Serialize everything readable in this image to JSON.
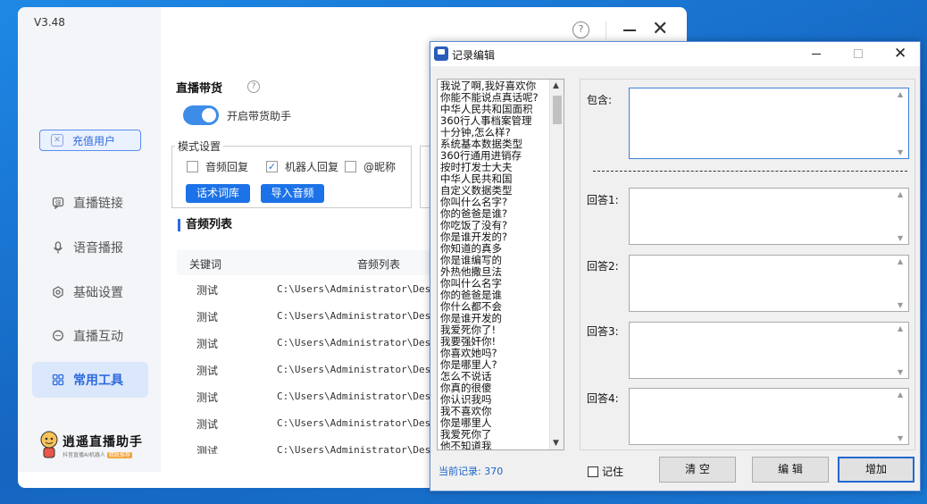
{
  "app": {
    "version": "V3.48",
    "vip_label": "充值用户",
    "nav": [
      {
        "label": "直播链接",
        "icon": "bullet-comment-icon"
      },
      {
        "label": "语音播报",
        "icon": "microphone-icon"
      },
      {
        "label": "基础设置",
        "icon": "gear-icon"
      },
      {
        "label": "直播互动",
        "icon": "chat-bubble-icon"
      },
      {
        "label": "常用工具",
        "icon": "grid-icon",
        "active": true
      }
    ],
    "logo": {
      "name": "逍遥直播助手",
      "subtitle": "抖音直播AI机器人",
      "tag": "精致推荐"
    },
    "section_title": "直播带货",
    "toggle_label": "开启带货助手",
    "mode": {
      "legend": "模式设置",
      "audio_reply": "音频回复",
      "robot_reply": "机器人回复",
      "nickname": "@昵称",
      "btn_wordlib": "话术词库",
      "btn_import": "导入音频"
    },
    "audio_list": {
      "title": "音频列表",
      "col_keyword": "关键词",
      "col_list": "音频列表",
      "rows": [
        {
          "keyword": "测试",
          "path": "C:\\Users\\Administrator\\Deskt"
        },
        {
          "keyword": "测试",
          "path": "C:\\Users\\Administrator\\Deskt"
        },
        {
          "keyword": "测试",
          "path": "C:\\Users\\Administrator\\Deskt"
        },
        {
          "keyword": "测试",
          "path": "C:\\Users\\Administrator\\Deskt"
        },
        {
          "keyword": "测试",
          "path": "C:\\Users\\Administrator\\Deskt"
        },
        {
          "keyword": "测试",
          "path": "C:\\Users\\Administrator\\Deskt"
        },
        {
          "keyword": "测试",
          "path": "C:\\Users\\Administrator\\Deskt"
        }
      ]
    }
  },
  "editor": {
    "title": "记录编辑",
    "records": [
      "我说了啊,我好喜欢你",
      "你能不能说点真话呢?",
      "中华人民共和国面积",
      "360行人事档案管理",
      "十分钟,怎么样?",
      "系统基本数据类型",
      "360行通用进销存",
      "按时打发士大夫",
      "中华人民共和国",
      "自定义数据类型",
      "你叫什么名字?",
      "你的爸爸是谁?",
      "你吃饭了没有?",
      "你是谁开发的?",
      "你知道的真多",
      "你是谁编写的",
      "外热他撒旦法",
      "你叫什么名字",
      "你的爸爸是谁",
      "你什么都不会",
      "你是谁开发的",
      "我爱死你了!",
      "我要强奸你!",
      "你喜欢她吗?",
      "你是哪里人?",
      "怎么不说话",
      "你真的很傻",
      "你认识我吗",
      "我不喜欢你",
      "你是哪里人",
      "我爱死你了",
      "他不知道我"
    ],
    "count_label": "当前记录: 370",
    "contains_label": "包含:",
    "answer_labels": [
      "回答1:",
      "回答2:",
      "回答3:",
      "回答4:"
    ],
    "remember_label": "记住",
    "btn_clear": "清  空",
    "btn_edit": "编  辑",
    "btn_add": "增加"
  }
}
